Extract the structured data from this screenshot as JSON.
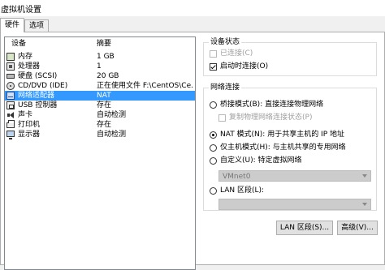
{
  "window": {
    "title": "虚拟机设置"
  },
  "tabs": [
    {
      "label": "硬件"
    },
    {
      "label": "选项"
    }
  ],
  "device_list": {
    "columns": {
      "device": "设备",
      "summary": "摘要"
    },
    "rows": [
      {
        "name": "内存",
        "summary": "1 GB",
        "icon": "memory-icon"
      },
      {
        "name": "处理器",
        "summary": "1",
        "icon": "processor-icon"
      },
      {
        "name": "硬盘 (SCSI)",
        "summary": "20 GB",
        "icon": "hard-disk-icon"
      },
      {
        "name": "CD/DVD (IDE)",
        "summary": "正在使用文件 F:\\CentOS\\Ce...",
        "icon": "cd-dvd-icon"
      },
      {
        "name": "网络适配器",
        "summary": "NAT",
        "icon": "network-adapter-icon",
        "selected": true
      },
      {
        "name": "USB 控制器",
        "summary": "存在",
        "icon": "usb-icon"
      },
      {
        "name": "声卡",
        "summary": "自动检测",
        "icon": "sound-icon"
      },
      {
        "name": "打印机",
        "summary": "存在",
        "icon": "printer-icon"
      },
      {
        "name": "显示器",
        "summary": "自动检测",
        "icon": "display-icon"
      }
    ]
  },
  "device_status": {
    "title": "设备状态",
    "connected": {
      "label": "已连接(C)",
      "checked": false,
      "enabled": false
    },
    "connect_at_power_on": {
      "label": "启动时连接(O)",
      "checked": true
    }
  },
  "network_connection": {
    "title": "网络连接",
    "bridged": {
      "label": "桥接模式(B): 直接连接物理网络"
    },
    "replicate": {
      "label": "复制物理网络连接状态(P)"
    },
    "nat": {
      "label": "NAT 模式(N): 用于共享主机的 IP 地址"
    },
    "host_only": {
      "label": "仅主机模式(H): 与主机共享的专用网络"
    },
    "custom": {
      "label": "自定义(U): 特定虚拟网络"
    },
    "custom_value": "VMnet0",
    "lan_segment": {
      "label": "LAN 区段(L):"
    },
    "lan_segment_value": ""
  },
  "buttons": {
    "lan_segment": "LAN 区段(S)...",
    "advanced": "高级(V)..."
  }
}
